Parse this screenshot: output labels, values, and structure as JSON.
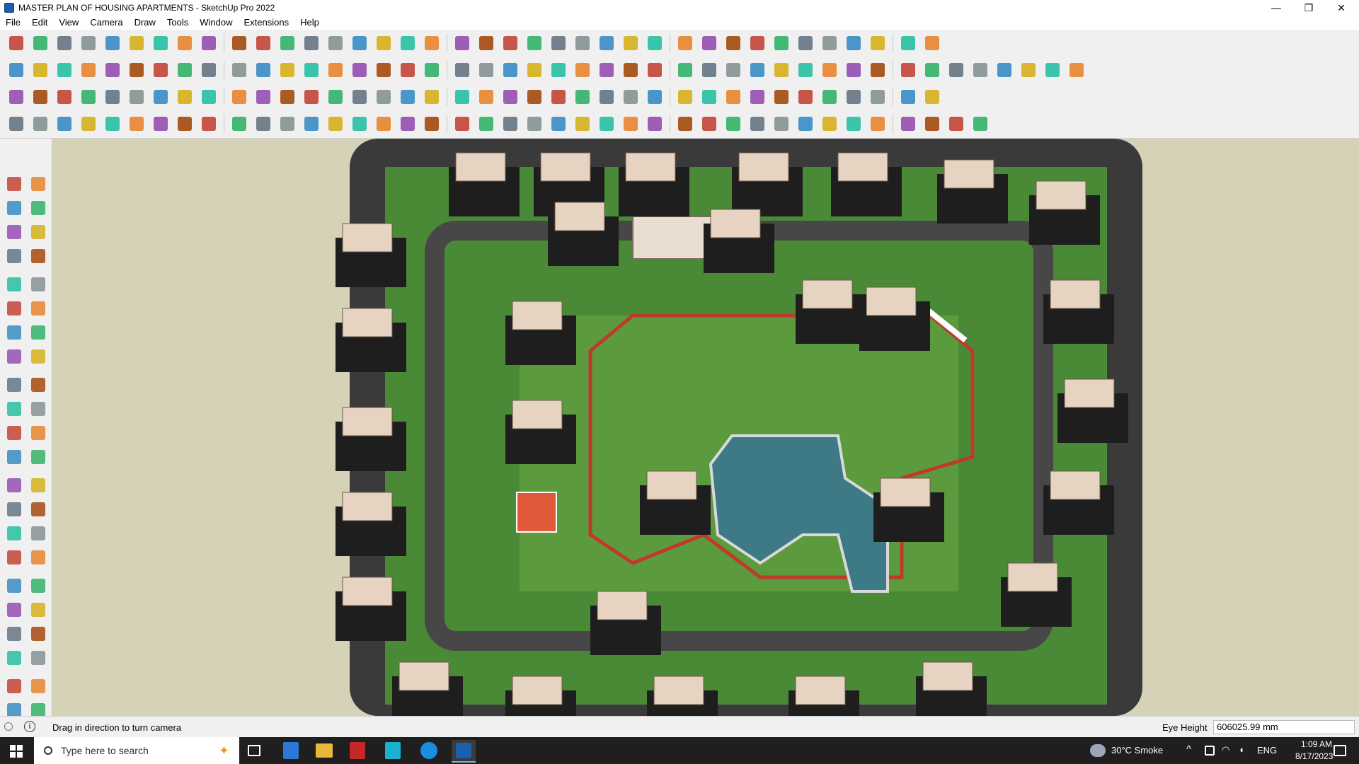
{
  "window": {
    "title": "MASTER PLAN OF HOUSING APARTMENTS - SketchUp Pro 2022"
  },
  "window_controls": {
    "minimize": "—",
    "maximize": "❐",
    "close": "✕"
  },
  "menu": [
    "File",
    "Edit",
    "View",
    "Camera",
    "Draw",
    "Tools",
    "Window",
    "Extensions",
    "Help"
  ],
  "toolbar_icon_colors": [
    "#c0392b",
    "#e67e22",
    "#2e86c1",
    "#27ae60",
    "#8e44ad",
    "#d4ac0d",
    "#5d6d7e",
    "#a04000",
    "#1abc9c",
    "#7f8c8d"
  ],
  "status": {
    "message": "Drag in direction to turn camera",
    "eye_height_label": "Eye Height",
    "eye_height_value": "606025.99 mm"
  },
  "taskbar": {
    "search_placeholder": "Type here to search",
    "weather": "30°C  Smoke",
    "language": "ENG",
    "time": "1:09 AM",
    "date": "8/17/2023"
  },
  "colors": {
    "viewport_bg": "#d6d2b7",
    "grass": "#4e8a35",
    "road": "#4a4a4a",
    "building_roof": "#e6d3c2",
    "water": "#3d7a85",
    "running_track": "#c0392b"
  }
}
